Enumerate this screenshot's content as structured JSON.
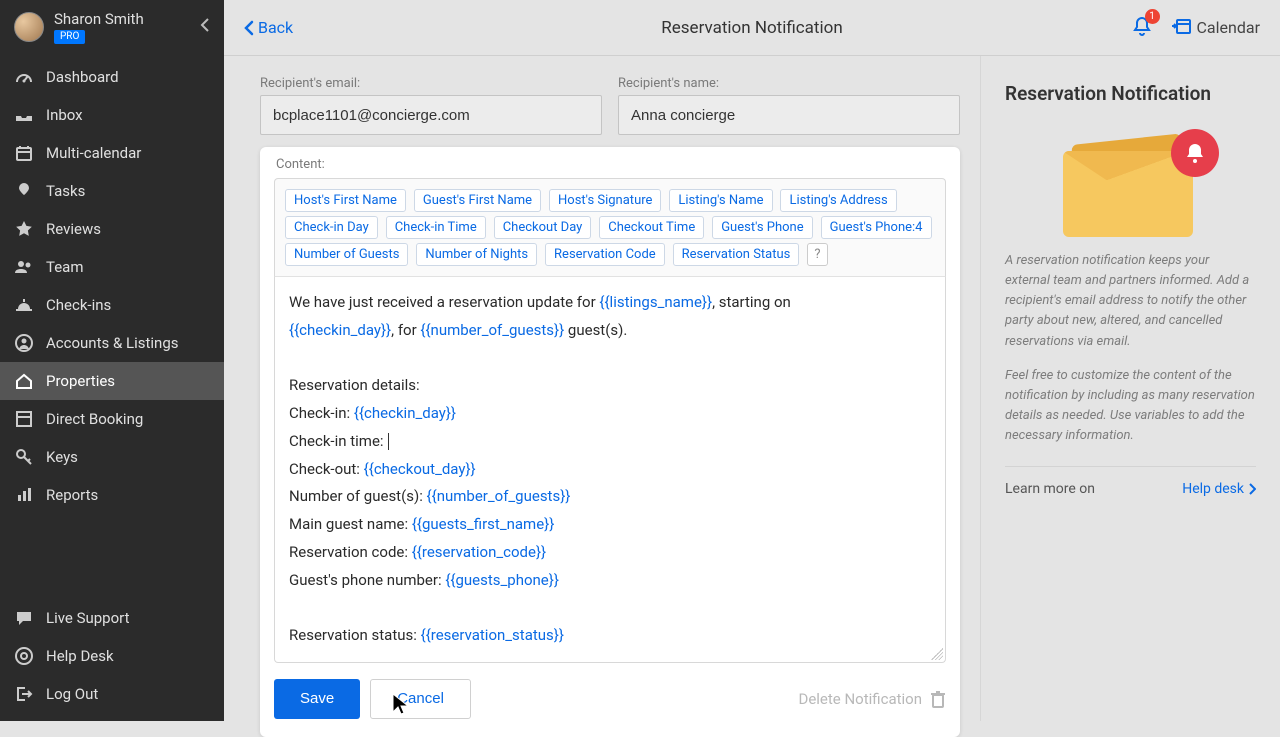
{
  "user": {
    "name": "Sharon Smith",
    "badge": "PRO"
  },
  "sidebar": {
    "items": [
      {
        "label": "Dashboard",
        "icon": "gauge"
      },
      {
        "label": "Inbox",
        "icon": "inbox"
      },
      {
        "label": "Multi-calendar",
        "icon": "calendar"
      },
      {
        "label": "Tasks",
        "icon": "pin"
      },
      {
        "label": "Reviews",
        "icon": "star"
      },
      {
        "label": "Team",
        "icon": "people"
      },
      {
        "label": "Check-ins",
        "icon": "bell"
      },
      {
        "label": "Accounts & Listings",
        "icon": "user-circle"
      },
      {
        "label": "Properties",
        "icon": "home",
        "active": true
      },
      {
        "label": "Direct Booking",
        "icon": "grid"
      },
      {
        "label": "Keys",
        "icon": "key"
      },
      {
        "label": "Reports",
        "icon": "chart"
      }
    ],
    "bottom": [
      {
        "label": "Live Support",
        "icon": "chat"
      },
      {
        "label": "Help Desk",
        "icon": "lifebuoy"
      },
      {
        "label": "Log Out",
        "icon": "logout"
      }
    ]
  },
  "topbar": {
    "back": "Back",
    "title": "Reservation Notification",
    "notification_count": "1",
    "calendar": "Calendar"
  },
  "form": {
    "email_label": "Recipient's email:",
    "email_value": "bcplace1101@concierge.com",
    "name_label": "Recipient's name:",
    "name_value": "Anna concierge",
    "content_label": "Content:",
    "tokens": [
      "Host's First Name",
      "Guest's First Name",
      "Host's Signature",
      "Listing's Name",
      "Listing's Address",
      "Check-in Day",
      "Check-in Time",
      "Checkout Day",
      "Checkout Time",
      "Guest's Phone",
      "Guest's Phone:4",
      "Number of Guests",
      "Number of Nights",
      "Reservation Code",
      "Reservation Status"
    ],
    "help_token": "?",
    "body": {
      "line1_a": "We have just received a reservation update for ",
      "line1_b": ", starting on ",
      "line2_a": ", for  ",
      "line2_b": " guest(s).",
      "listings_name": "{{listings_name}}",
      "checkin_day": "{{checkin_day}}",
      "number_of_guests": "{{number_of_guests}}",
      "details_heading": "Reservation details:",
      "checkin_label": "Check-in: ",
      "checkin_time_label": "Check-in time: ",
      "checkout_label": "Check-out: ",
      "checkout_day": "{{checkout_day}}",
      "num_guests_label": "Number of guest(s): ",
      "main_guest_label": "Main guest name: ",
      "guests_first_name": "{{guests_first_name}}",
      "res_code_label": "Reservation code: ",
      "reservation_code": "{{reservation_code}}",
      "phone_label": "Guest's phone number: ",
      "guests_phone": "{{guests_phone}}",
      "status_label": "Reservation status: ",
      "reservation_status": "{{reservation_status}}"
    },
    "save": "Save",
    "cancel": "Cancel",
    "delete": "Delete Notification"
  },
  "aside": {
    "heading": "Reservation Notification",
    "p1": "A reservation notification keeps your external team and partners informed. Add a recipient's email address to notify the other party about new, altered, and cancelled reservations via email.",
    "p2": "Feel free to customize the content of the notification by including as many reservation details as needed. Use variables to add the necessary information.",
    "learn": "Learn more on",
    "help": "Help desk"
  }
}
